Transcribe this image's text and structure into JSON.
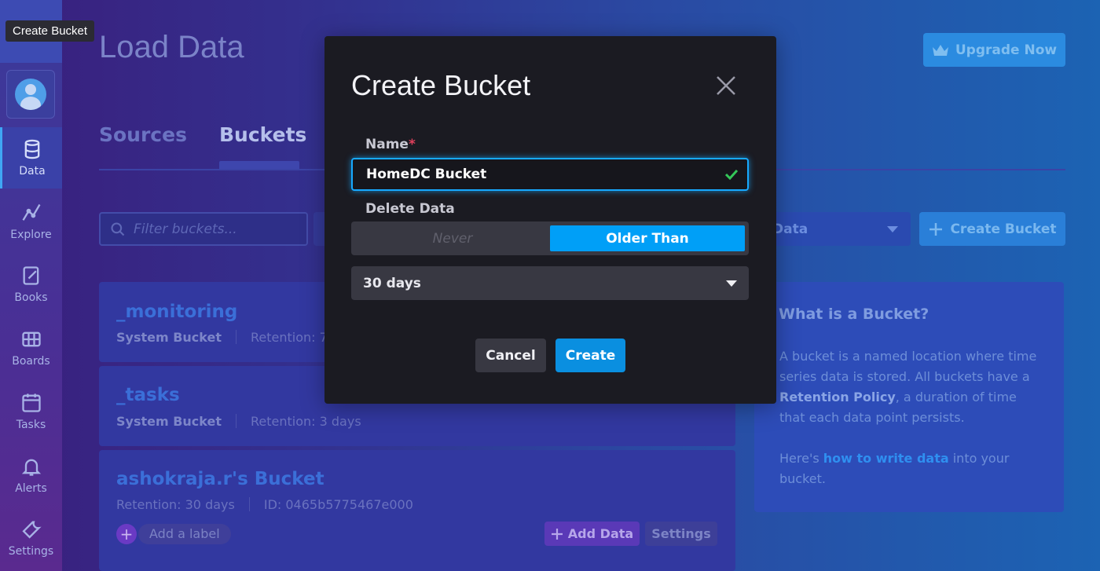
{
  "tooltip": "Create Bucket",
  "sidebar": {
    "items": [
      {
        "label": "Data",
        "icon": "database-icon"
      },
      {
        "label": "Explore",
        "icon": "graph-icon"
      },
      {
        "label": "Books",
        "icon": "notebook-icon"
      },
      {
        "label": "Boards",
        "icon": "dashboard-icon"
      },
      {
        "label": "Tasks",
        "icon": "calendar-icon"
      },
      {
        "label": "Alerts",
        "icon": "bell-icon"
      },
      {
        "label": "Settings",
        "icon": "wrench-icon"
      }
    ]
  },
  "header": {
    "title": "Load Data",
    "upgrade_label": "Upgrade Now"
  },
  "tabs": [
    "Sources",
    "Buckets"
  ],
  "toolbar": {
    "filter_placeholder": "Filter buckets...",
    "add_data_label": "Data",
    "create_bucket_label": "Create Bucket"
  },
  "buckets": [
    {
      "name": "_monitoring",
      "type": "System Bucket",
      "retention": "Retention: 7"
    },
    {
      "name": "_tasks",
      "type": "System Bucket",
      "retention": "Retention: 3 days"
    },
    {
      "name": "ashokraja.r's Bucket",
      "retention": "Retention: 30 days",
      "id": "ID: 0465b5775467e000",
      "add_label": "Add a label",
      "add_data": "Add Data",
      "settings": "Settings"
    }
  ],
  "info": {
    "title": "What is a Bucket?",
    "p1_a": "A bucket is a named location where time series data is stored. All buckets have a ",
    "p1_b": "Retention Policy",
    "p1_c": ", a duration of time that each data point persists.",
    "p2_a": "Here's ",
    "p2_link": "how to write data",
    "p2_c": " into your bucket."
  },
  "modal": {
    "title": "Create Bucket",
    "name_label": "Name",
    "name_required": "*",
    "name_value": "HomeDC Bucket",
    "delete_label": "Delete Data",
    "delete_options": [
      "Never",
      "Older Than"
    ],
    "delete_selected": "Older Than",
    "retention_value": "30 days",
    "cancel_label": "Cancel",
    "create_label": "Create"
  },
  "colors": {
    "accent": "#009ff7",
    "modal_bg": "#1b1b22",
    "required": "#e0405c",
    "valid": "#34c759"
  }
}
